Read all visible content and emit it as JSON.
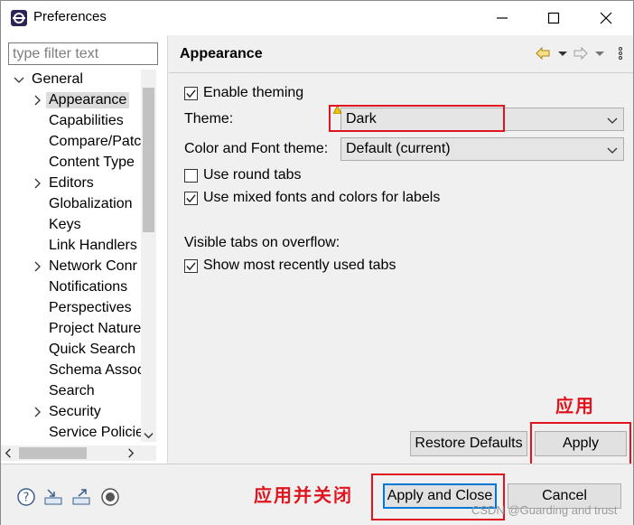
{
  "window": {
    "title": "Preferences"
  },
  "filter": {
    "placeholder": "type filter text"
  },
  "tree": {
    "root": "General",
    "items": [
      {
        "label": "Appearance",
        "expandable": true,
        "selected": true
      },
      {
        "label": "Capabilities",
        "expandable": false
      },
      {
        "label": "Compare/Patc",
        "expandable": false
      },
      {
        "label": "Content Type",
        "expandable": false
      },
      {
        "label": "Editors",
        "expandable": true
      },
      {
        "label": "Globalization",
        "expandable": false
      },
      {
        "label": "Keys",
        "expandable": false
      },
      {
        "label": "Link Handlers",
        "expandable": false
      },
      {
        "label": "Network Conr",
        "expandable": true
      },
      {
        "label": "Notifications",
        "expandable": false
      },
      {
        "label": "Perspectives",
        "expandable": false
      },
      {
        "label": "Project Nature",
        "expandable": false
      },
      {
        "label": "Quick Search",
        "expandable": false
      },
      {
        "label": "Schema Assoc",
        "expandable": false
      },
      {
        "label": "Search",
        "expandable": false
      },
      {
        "label": "Security",
        "expandable": true
      },
      {
        "label": "Service Policie",
        "expandable": false
      }
    ]
  },
  "page": {
    "title": "Appearance",
    "enable_theming": "Enable theming",
    "theme_label": "Theme:",
    "theme_value": "Dark",
    "color_font_label": "Color and Font theme:",
    "color_font_value": "Default (current)",
    "round_tabs": "Use round tabs",
    "mixed_fonts": "Use mixed fonts and colors for labels",
    "visible_tabs_label": "Visible tabs on overflow:",
    "recent_tabs": "Show most recently used tabs",
    "restore_defaults": "Restore Defaults",
    "apply": "Apply"
  },
  "checks": {
    "enable_theming": true,
    "round_tabs": false,
    "mixed_fonts": true,
    "recent_tabs": true
  },
  "bottom": {
    "apply_and_close": "Apply and Close",
    "cancel": "Cancel",
    "icons": [
      "help-icon",
      "import-icon",
      "export-icon",
      "record-icon"
    ]
  },
  "annotations": {
    "apply_note": "应用",
    "apply_close_note": "应用并关闭"
  },
  "watermark": "CSDN @Guarding and trust",
  "colors": {
    "annotation": "#e0141e",
    "focus_border": "#0078d7"
  }
}
